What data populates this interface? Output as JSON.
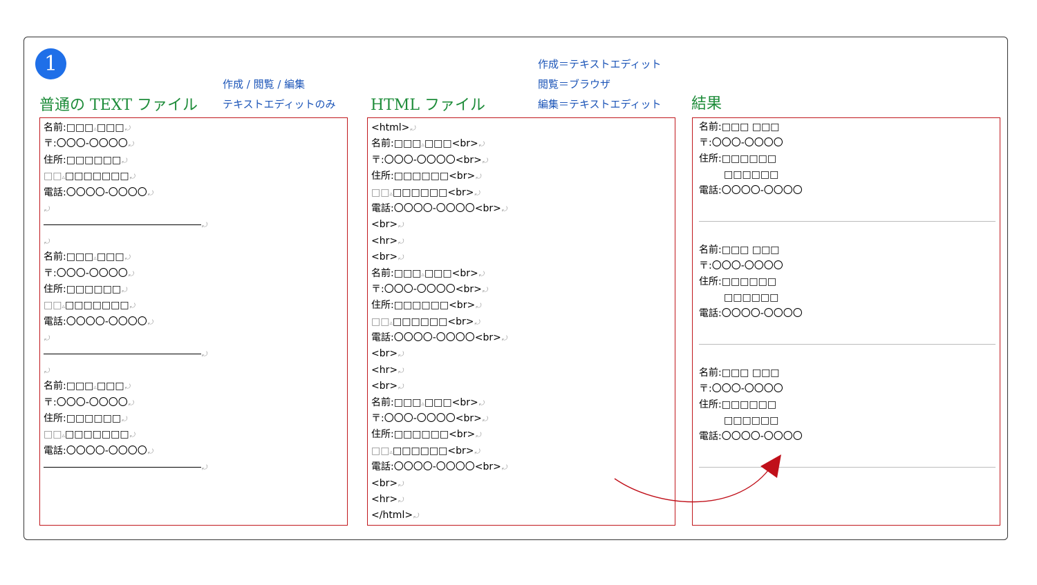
{
  "step_number": "1",
  "colors": {
    "badge": "#1f6fe8",
    "title": "#1e8c3a",
    "note": "#1c55b8",
    "panel_border": "#c0161b",
    "arrow": "#c0101a"
  },
  "columns": {
    "text_file": {
      "title": "普通の TEXT ファイル",
      "notes": [
        "作成 / 閲覧 / 編集",
        "テキストエディットのみ"
      ]
    },
    "html_file": {
      "title": "HTML ファイル",
      "notes": [
        "作成＝テキストエディット",
        "閲覧＝ブラウザ",
        "編集＝テキストエディット"
      ]
    },
    "result": {
      "title": "結果"
    }
  },
  "text_panel": {
    "records": [
      {
        "name_a": "名前:□□□",
        "name_b": "□□□",
        "zip": "〒:〇〇〇-〇〇〇〇",
        "addr1": "住所:□□□□□□",
        "addr2_a": "□□",
        "addr2_b": "□□□□□□□",
        "phone": "電話:〇〇〇〇-〇〇〇〇"
      },
      {
        "name_a": "名前:□□□",
        "name_b": "□□□",
        "zip": "〒:〇〇〇-〇〇〇〇",
        "addr1": "住所:□□□□□□",
        "addr2_a": "□□",
        "addr2_b": "□□□□□□□",
        "phone": "電話:〇〇〇〇-〇〇〇〇"
      },
      {
        "name_a": "名前:□□□",
        "name_b": "□□□",
        "zip": "〒:〇〇〇-〇〇〇〇",
        "addr1": "住所:□□□□□□",
        "addr2_a": "□□",
        "addr2_b": "□□□□□□□",
        "phone": "電話:〇〇〇〇-〇〇〇〇"
      }
    ]
  },
  "html_panel": {
    "html_open": "<html>",
    "html_close": "</html>",
    "br": "<br>",
    "hr": "<hr>",
    "records": [
      {
        "name_a": "名前:□□□",
        "name_b": "□□□<br>",
        "zip": "〒:〇〇〇-〇〇〇〇<br>",
        "addr1": "住所:□□□□□□<br>",
        "addr2_a": "□□",
        "addr2_b": "□□□□□□<br>",
        "phone": "電話:〇〇〇〇-〇〇〇〇<br>"
      },
      {
        "name_a": "名前:□□□",
        "name_b": "□□□<br>",
        "zip": "〒:〇〇〇-〇〇〇〇<br>",
        "addr1": "住所:□□□□□□<br>",
        "addr2_a": "□□",
        "addr2_b": "□□□□□□<br>",
        "phone": "電話:〇〇〇〇-〇〇〇〇<br>"
      },
      {
        "name_a": "名前:□□□",
        "name_b": "□□□<br>",
        "zip": "〒:〇〇〇-〇〇〇〇<br>",
        "addr1": "住所:□□□□□□<br>",
        "addr2_a": "□□",
        "addr2_b": "□□□□□□<br>",
        "phone": "電話:〇〇〇〇-〇〇〇〇<br>"
      }
    ]
  },
  "result_panel": {
    "records": [
      {
        "name": "名前:□□□ □□□",
        "zip": "〒:〇〇〇-〇〇〇〇",
        "addr1": "住所:□□□□□□",
        "addr2": "□□□□□□",
        "phone": "電話:〇〇〇〇-〇〇〇〇"
      },
      {
        "name": "名前:□□□ □□□",
        "zip": "〒:〇〇〇-〇〇〇〇",
        "addr1": "住所:□□□□□□",
        "addr2": "□□□□□□",
        "phone": "電話:〇〇〇〇-〇〇〇〇"
      },
      {
        "name": "名前:□□□ □□□",
        "zip": "〒:〇〇〇-〇〇〇〇",
        "addr1": "住所:□□□□□□",
        "addr2": "□□□□□□",
        "phone": "電話:〇〇〇〇-〇〇〇〇"
      }
    ]
  },
  "markers": {
    "return": "⤾",
    "space": "▵"
  }
}
